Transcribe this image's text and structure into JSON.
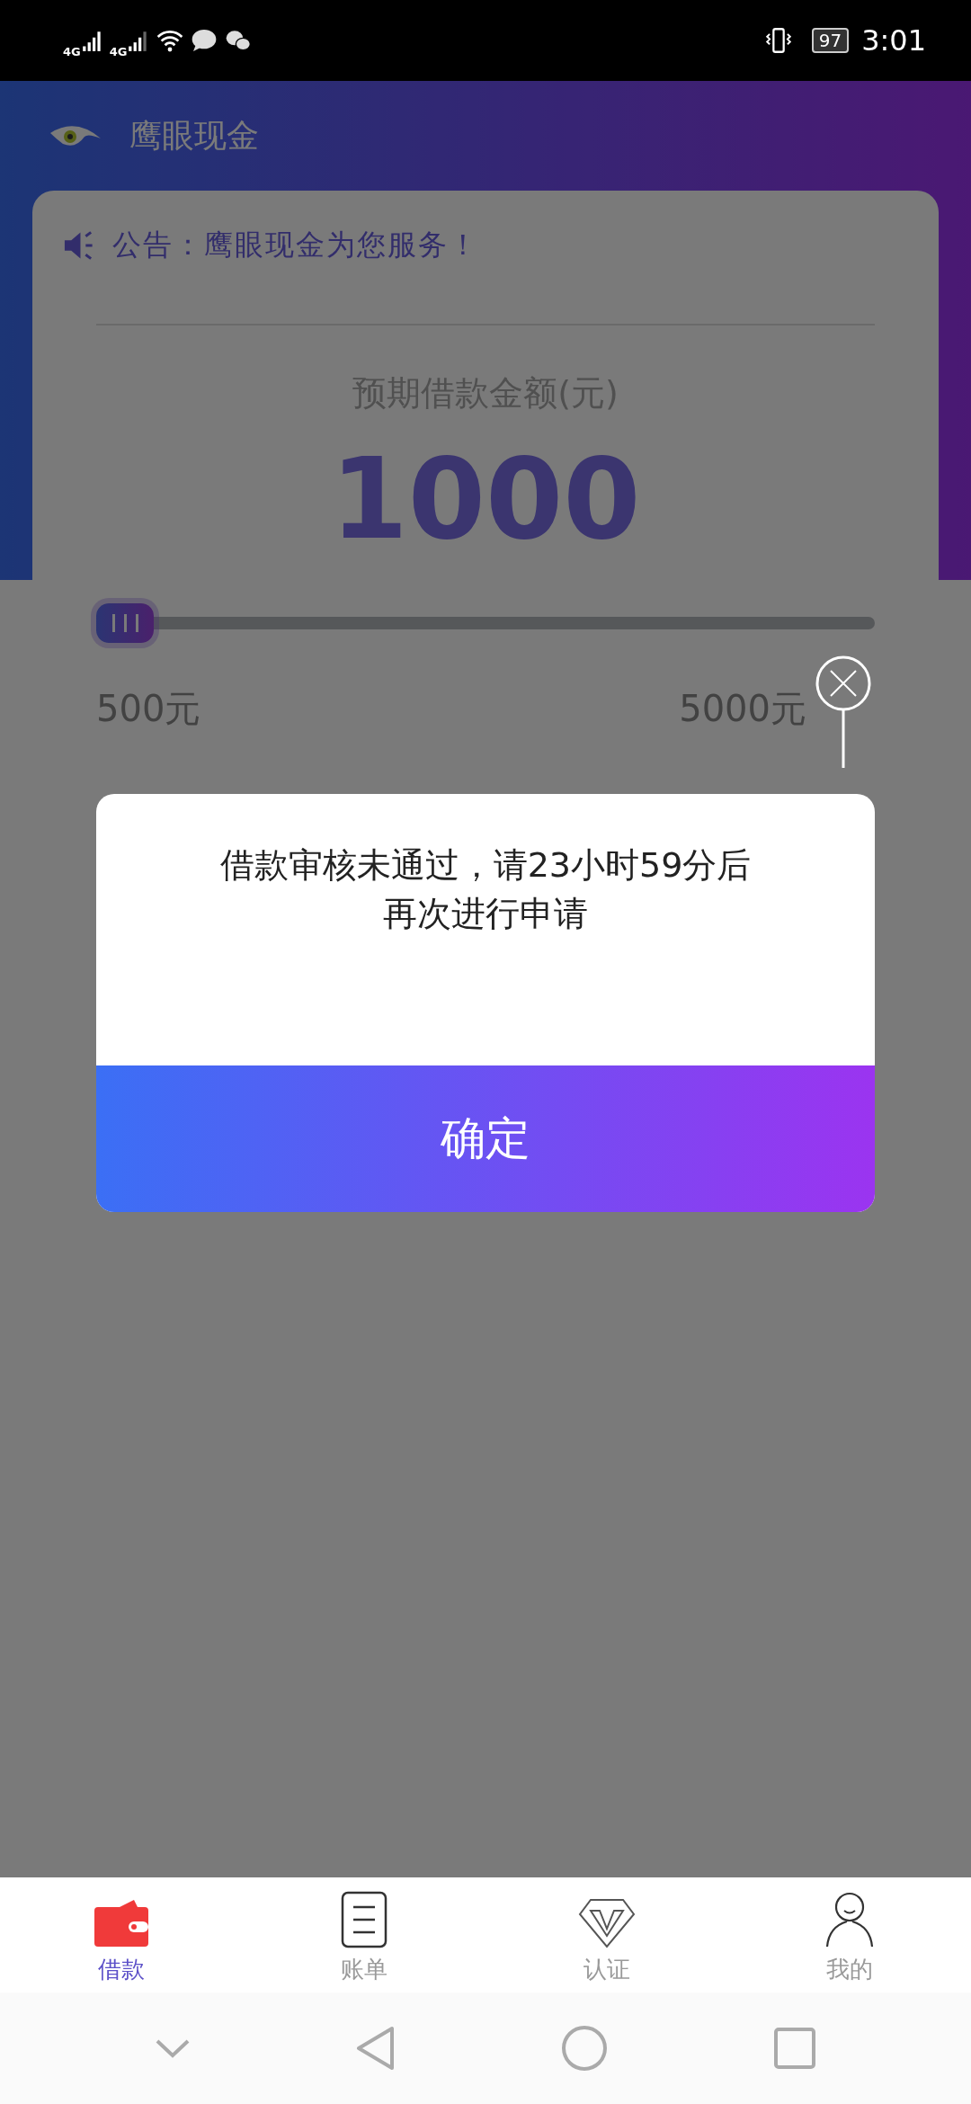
{
  "status_bar": {
    "network_1": "4G",
    "network_2": "4G",
    "battery": "97",
    "time": "3:01"
  },
  "header": {
    "title": "鹰眼现金"
  },
  "notice": {
    "text": "公告：鹰眼现金为您服务！"
  },
  "loan": {
    "label": "预期借款金额(元)",
    "amount": "1000",
    "slider": {
      "level": 0
    },
    "min_label": "500元",
    "max_label": "5000元"
  },
  "dialog": {
    "message": "借款审核未通过，请23小时59分后再次进行申请",
    "button": "确定"
  },
  "tabs": [
    {
      "label": "借款",
      "kind": "wallet",
      "selected": true
    },
    {
      "label": "账单",
      "kind": "bill",
      "selected": false
    },
    {
      "label": "认证",
      "kind": "diamond",
      "selected": false
    },
    {
      "label": "我的",
      "kind": "person",
      "selected": false
    }
  ]
}
